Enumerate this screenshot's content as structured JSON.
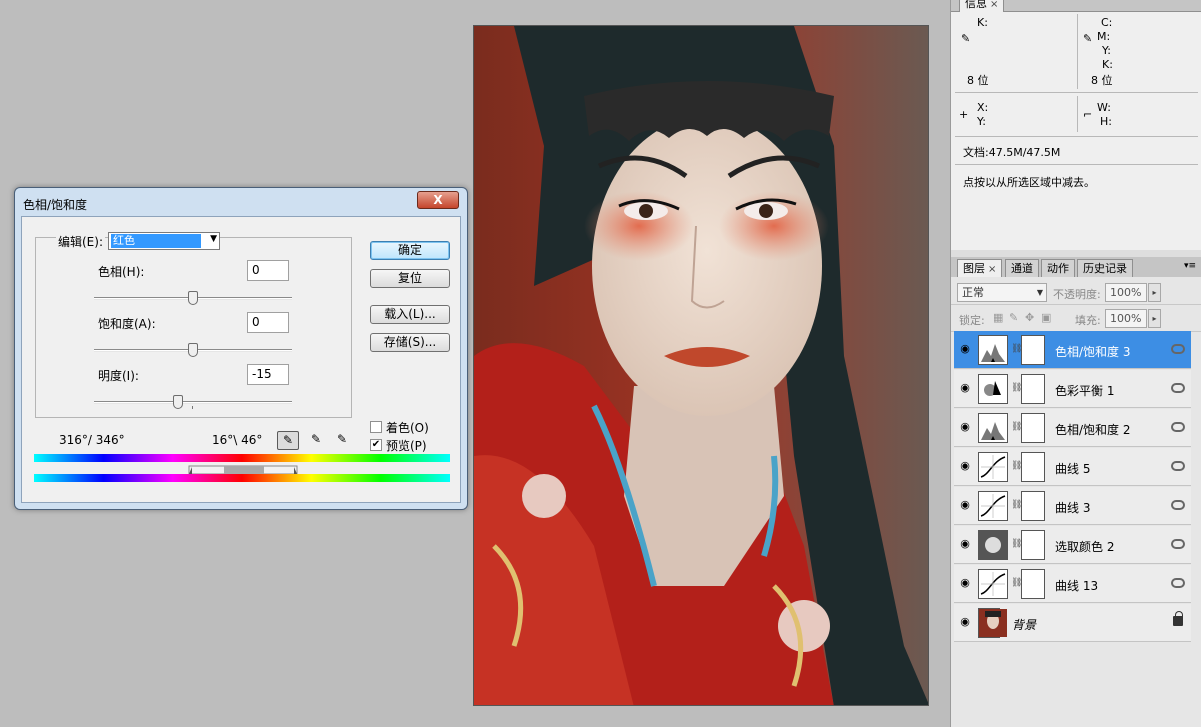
{
  "info_panel": {
    "tab_label": "信息",
    "tab_close": "×",
    "k_label": "K:",
    "cmyk_labels": [
      "C:",
      "M:",
      "Y:",
      "K:"
    ],
    "bit_left": "8 位",
    "bit_right": "8 位",
    "x_label": "X:",
    "y_label": "Y:",
    "w_label": "W:",
    "h_label": "H:",
    "doc_size": "文档:47.5M/47.5M",
    "hint": "点按以从所选区域中减去。"
  },
  "layers_panel": {
    "tabs": [
      {
        "label": "图层",
        "active": true
      },
      {
        "label": "通道",
        "active": false
      },
      {
        "label": "动作",
        "active": false
      },
      {
        "label": "历史记录",
        "active": false
      }
    ],
    "tab_close": "×",
    "blend_mode": "正常",
    "opacity_label": "不透明度:",
    "opacity_value": "100%",
    "lock_label": "锁定:",
    "fill_label": "填充:",
    "fill_value": "100%",
    "layers": [
      {
        "name": "色相/饱和度 3",
        "selected": true,
        "thumb": "hue-sat"
      },
      {
        "name": "色彩平衡 1",
        "selected": false,
        "thumb": "color-balance"
      },
      {
        "name": "色相/饱和度 2",
        "selected": false,
        "thumb": "hue-sat"
      },
      {
        "name": "曲线 5",
        "selected": false,
        "thumb": "curves"
      },
      {
        "name": "曲线 3",
        "selected": false,
        "thumb": "curves"
      },
      {
        "name": "选取颜色 2",
        "selected": false,
        "thumb": "selective-color"
      },
      {
        "name": "曲线 13",
        "selected": false,
        "thumb": "curves"
      },
      {
        "name": "背景",
        "selected": false,
        "thumb": "photo"
      }
    ]
  },
  "dialog": {
    "title": "色相/饱和度",
    "close_label": "X",
    "edit_label": "编辑(E):",
    "edit_value": "红色",
    "hue_label": "色相(H):",
    "hue_value": "0",
    "saturation_label": "饱和度(A):",
    "saturation_value": "0",
    "lightness_label": "明度(I):",
    "lightness_value": "-15",
    "hue_level": 0,
    "saturation_level": 0,
    "lightness_level": -15,
    "ok_label": "确定",
    "reset_label": "复位",
    "load_label": "载入(L)...",
    "save_label": "存储(S)...",
    "colorize_label": "着色(O)",
    "colorize_checked": false,
    "preview_label": "预览(P)",
    "preview_checked": true,
    "range_left": "316°/ 346°",
    "range_right": "16°\\ 46°"
  }
}
